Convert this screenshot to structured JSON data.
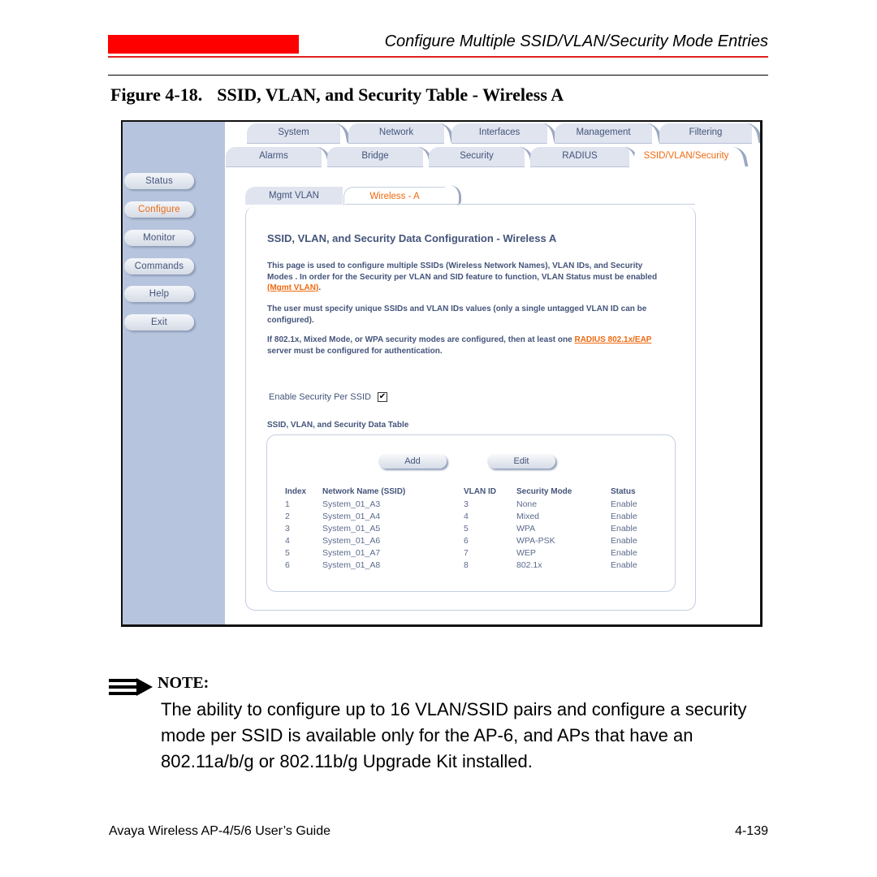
{
  "page_header": {
    "section_title": "Configure Multiple SSID/VLAN/Security Mode Entries",
    "accent_color": "#ff0000"
  },
  "figure": {
    "number": "Figure 4-18.",
    "title": "SSID, VLAN, and Security Table - Wireless A"
  },
  "screenshot": {
    "sidebar": {
      "items": [
        {
          "label": "Status",
          "active": false
        },
        {
          "label": "Configure",
          "active": true
        },
        {
          "label": "Monitor",
          "active": false
        },
        {
          "label": "Commands",
          "active": false
        },
        {
          "label": "Help",
          "active": false
        },
        {
          "label": "Exit",
          "active": false
        }
      ]
    },
    "tabs_row1": [
      {
        "label": "System"
      },
      {
        "label": "Network"
      },
      {
        "label": "Interfaces"
      },
      {
        "label": "Management"
      },
      {
        "label": "Filtering"
      }
    ],
    "tabs_row2": [
      {
        "label": "Alarms",
        "active": false
      },
      {
        "label": "Bridge",
        "active": false
      },
      {
        "label": "Security",
        "active": false
      },
      {
        "label": "RADIUS",
        "active": false
      },
      {
        "label": "SSID/VLAN/Security",
        "active": true
      }
    ],
    "sub_tabs": [
      {
        "label": "Mgmt VLAN",
        "active": false
      },
      {
        "label": "Wireless - A",
        "active": true
      }
    ],
    "config_title": "SSID, VLAN, and Security Data Configuration - Wireless A",
    "para1": {
      "text_before": "This page is used to configure multiple SSIDs (Wireless Network Names), VLAN IDs, and Security Modes . In order for the Security per VLAN and SID feature to function, VLAN Status must be enabled ",
      "link": "(Mgmt VLAN)",
      "text_after": "."
    },
    "para2": "The user must specify unique SSIDs and VLAN IDs values (only a single untagged VLAN ID can be configured).",
    "para3": {
      "text_before": "If 802.1x, Mixed Mode, or WPA security modes are configured, then at least one ",
      "link": "RADIUS 802.1x/EAP",
      "text_after": " server must be configured for authentication."
    },
    "enable_security_label": "Enable Security Per SSID",
    "enable_security_checked": true,
    "enable_security_glyph": "✔",
    "table_title": "SSID, VLAN, and Security Data Table",
    "buttons": {
      "add": "Add",
      "edit": "Edit"
    },
    "table": {
      "headers": [
        "Index",
        "Network Name (SSID)",
        "VLAN ID",
        "Security Mode",
        "Status"
      ],
      "rows": [
        [
          "1",
          "System_01_A3",
          "3",
          "None",
          "Enable"
        ],
        [
          "2",
          "System_01_A4",
          "4",
          "Mixed",
          "Enable"
        ],
        [
          "3",
          "System_01_A5",
          "5",
          "WPA",
          "Enable"
        ],
        [
          "4",
          "System_01_A6",
          "6",
          "WPA-PSK",
          "Enable"
        ],
        [
          "5",
          "System_01_A7",
          "7",
          "WEP",
          "Enable"
        ],
        [
          "6",
          "System_01_A8",
          "8",
          "802.1x",
          "Enable"
        ]
      ]
    },
    "colors": {
      "active": "#f06a10",
      "text": "#44547a",
      "sidebar_bg": "#b6c4dd"
    }
  },
  "note": {
    "icon": "note-arrow-icon",
    "label": "NOTE:",
    "text": "The ability to configure up to 16 VLAN/SSID pairs and configure a security mode per SSID is available only for the AP-6, and APs that have an 802.11a/b/g or 802.11b/g Upgrade Kit installed."
  },
  "footer": {
    "guide_title": "Avaya Wireless AP-4/5/6 User’s Guide",
    "page_number": "4-139"
  }
}
